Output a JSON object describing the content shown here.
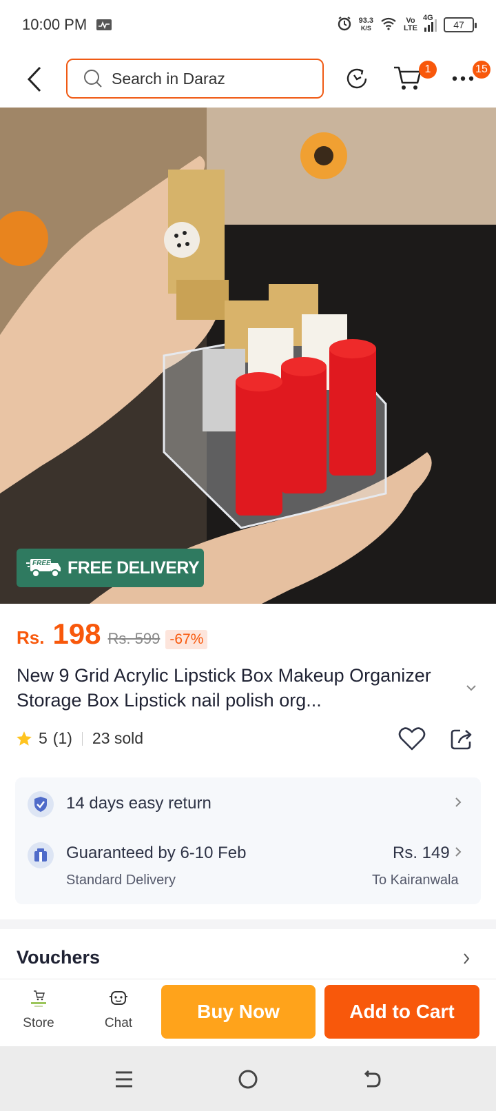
{
  "status_bar": {
    "time": "10:00 PM",
    "speed_value": "93.3",
    "speed_unit": "K/S",
    "volte": "Vo",
    "lte": "LTE",
    "network": "4G",
    "battery": "47"
  },
  "header": {
    "search_placeholder": "Search in Daraz",
    "cart_badge": "1",
    "more_badge": "15"
  },
  "product_image": {
    "free_delivery_tag": "FREE",
    "free_delivery_label": "FREE DELIVERY"
  },
  "price": {
    "currency": "Rs.",
    "current": "198",
    "original": "Rs. 599",
    "discount": "-67%"
  },
  "product": {
    "title": "New 9 Grid Acrylic Lipstick Box Makeup Organizer Storage Box Lipstick nail polish org...",
    "rating": "5",
    "rating_count": "(1)",
    "sold": "23 sold"
  },
  "service": {
    "return_text": "14 days easy return",
    "guarantee_text": "Guaranteed by 6-10 Feb",
    "delivery_type": "Standard Delivery",
    "delivery_price": "Rs. 149",
    "delivery_to": "To Kairanwala"
  },
  "vouchers": {
    "label": "Vouchers"
  },
  "bottom_bar": {
    "store_label": "Store",
    "chat_label": "Chat",
    "buy_now": "Buy Now",
    "add_to_cart": "Add to Cart"
  },
  "colors": {
    "brand_orange": "#f8580b",
    "buy_now": "#ffa31b",
    "free_delivery_green": "#2f7a60"
  }
}
